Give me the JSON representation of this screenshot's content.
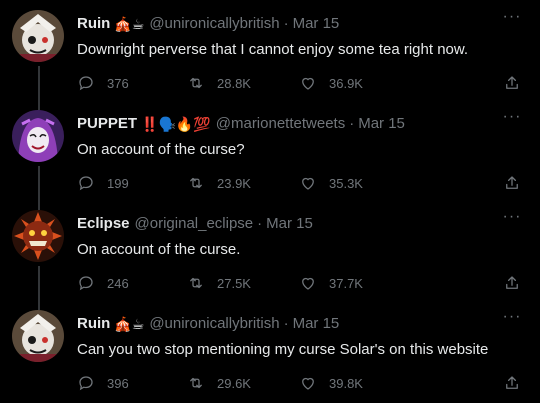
{
  "tweets": [
    {
      "name": "Ruin",
      "emoji": "🎪☕",
      "handle": "@unironicallybritish",
      "date": "Mar 15",
      "text": "Downright perverse that I cannot enjoy some tea right now.",
      "replies": "376",
      "retweets": "28.8K",
      "likes": "36.9K"
    },
    {
      "name": "PUPPET",
      "emoji": "‼️🗣️🔥💯",
      "handle": "@marionettetweets",
      "date": "Mar 15",
      "text": "On account of the curse?",
      "replies": "199",
      "retweets": "23.9K",
      "likes": "35.3K"
    },
    {
      "name": "Eclipse",
      "emoji": "",
      "handle": "@original_eclipse",
      "date": "Mar 15",
      "text": "On account of the curse.",
      "replies": "246",
      "retweets": "27.5K",
      "likes": "37.7K"
    },
    {
      "name": "Ruin",
      "emoji": "🎪☕",
      "handle": "@unironicallybritish",
      "date": "Mar 15",
      "text": "Can you two stop mentioning my curse Solar's on this website",
      "replies": "396",
      "retweets": "29.6K",
      "likes": "39.8K"
    }
  ],
  "colors": {
    "background": "#000000",
    "text": "#e7e9ea",
    "muted": "#71767b",
    "thread_line": "#333639"
  }
}
